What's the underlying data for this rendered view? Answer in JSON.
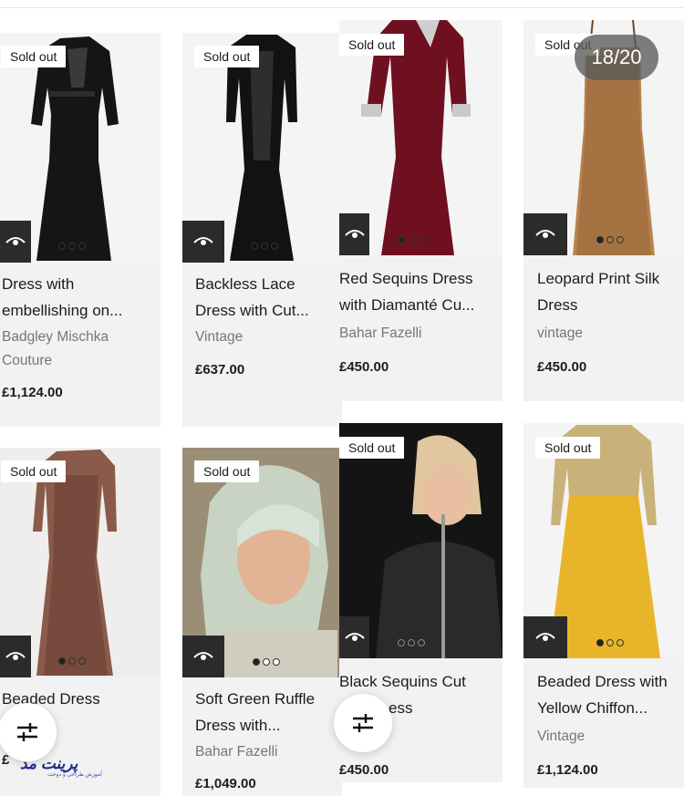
{
  "gallery": {
    "counter": "18/20"
  },
  "badge_text": "Sold out",
  "products": [
    {
      "title_lines": [
        "Dress with",
        "embellishing on..."
      ],
      "brand_lines": [
        "Badgley Mischka",
        "Couture"
      ],
      "price": "£1,124.00",
      "sold_out": true,
      "active_dot": 0
    },
    {
      "title_lines": [
        "Backless Lace",
        "Dress with Cut..."
      ],
      "brand_lines": [
        "Vintage"
      ],
      "price": "£637.00",
      "sold_out": true,
      "active_dot": 0
    },
    {
      "title_lines": [
        "Red Sequins Dress",
        "with Diamanté Cu..."
      ],
      "brand_lines": [
        "Bahar Fazelli"
      ],
      "price": "£450.00",
      "sold_out": true,
      "active_dot": 0
    },
    {
      "title_lines": [
        "Leopard Print Silk",
        "Dress"
      ],
      "brand_lines": [
        "vintage"
      ],
      "price": "£450.00",
      "sold_out": true,
      "active_dot": 0
    },
    {
      "title_lines": [
        "Beaded Dress"
      ],
      "brand_lines": [],
      "price": "£",
      "sold_out": true,
      "active_dot": 0
    },
    {
      "title_lines": [
        "Soft Green Ruffle",
        "Dress with..."
      ],
      "brand_lines": [
        "Bahar Fazelli"
      ],
      "price": "£1,049.00",
      "sold_out": true,
      "active_dot": 0
    },
    {
      "title_lines": [
        "Black Sequins Cut",
        "ess"
      ],
      "brand_lines": [],
      "price": "£450.00",
      "sold_out": true,
      "active_dot": 0
    },
    {
      "title_lines": [
        "Beaded Dress with",
        "Yellow Chiffon..."
      ],
      "brand_lines": [
        "Vintage"
      ],
      "price": "£1,124.00",
      "sold_out": true,
      "active_dot": 0
    }
  ],
  "icons": {
    "quick_view": "eye-icon",
    "filter": "sliders-icon"
  },
  "watermark": {
    "text": "پرینت مد",
    "sub": "آموزش طراحی و دوخت"
  },
  "colors": {
    "card_bg": "#f2f2f2",
    "dark_button": "#2b2b2b",
    "counter_bg": "#5a5a5a"
  }
}
